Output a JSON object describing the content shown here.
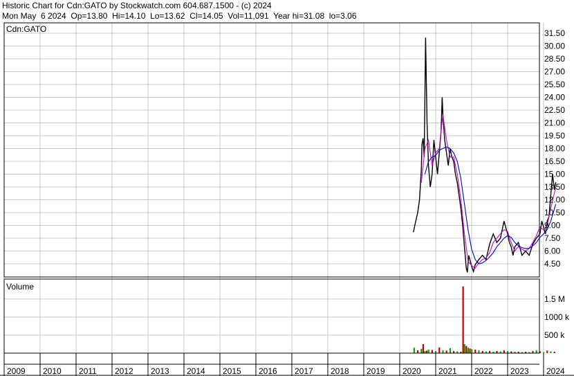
{
  "header": {
    "title": "Historic Chart for Cdn:GATO by Stockwatch.com 604.687.1500 - (c) 2024",
    "quote": "Mon May  6 2024  Op=13.80  Hi=14.10  Lo=13.62  Cl=14.05  Vol=11,091  Year hi=31.08  lo=3.06"
  },
  "chart_data": [
    {
      "type": "line",
      "panel_label": "Cdn:GATO",
      "ylim": [
        3.0,
        33.5
      ],
      "y_ticks": [
        "31.50",
        "30.00",
        "28.50",
        "27.00",
        "25.50",
        "24.00",
        "22.50",
        "21.00",
        "19.50",
        "18.00",
        "16.50",
        "15.00",
        "13.50",
        "12.00",
        "10.50",
        "9.00",
        "7.50",
        "6.00",
        "4.50"
      ],
      "x_ticks": [
        "2009",
        "2010",
        "2011",
        "2012",
        "2013",
        "2014",
        "2015",
        "2016",
        "2017",
        "2018",
        "2019",
        "2020",
        "2021",
        "2022",
        "2023",
        "2024"
      ],
      "grid": true,
      "series": [
        {
          "color": "#000000",
          "x": [
            2020.38,
            2020.42,
            2020.5,
            2020.55,
            2020.6,
            2020.62,
            2020.65,
            2020.68,
            2020.72,
            2020.76,
            2020.8,
            2020.85,
            2020.9,
            2020.95,
            2021.0,
            2021.05,
            2021.1,
            2021.15,
            2021.18,
            2021.2,
            2021.25,
            2021.3,
            2021.35,
            2021.4,
            2021.45,
            2021.5,
            2021.55,
            2021.6,
            2021.65,
            2021.7,
            2021.75,
            2021.8,
            2021.85,
            2021.88,
            2021.92,
            2021.95,
            2022.0,
            2022.05,
            2022.1,
            2022.2,
            2022.3,
            2022.4,
            2022.5,
            2022.6,
            2022.7,
            2022.8,
            2022.9,
            2023.0,
            2023.05,
            2023.1,
            2023.15,
            2023.2,
            2023.3,
            2023.4,
            2023.5,
            2023.6,
            2023.7,
            2023.8,
            2023.9,
            2023.95,
            2024.0,
            2024.05,
            2024.1,
            2024.15,
            2024.2,
            2024.25,
            2024.3,
            2024.34
          ],
          "values": [
            8.2,
            9.0,
            10.5,
            12.0,
            15.5,
            18.5,
            19.2,
            17.0,
            31.0,
            21.0,
            16.0,
            13.5,
            15.0,
            19.0,
            17.0,
            15.0,
            17.5,
            20.0,
            24.0,
            22.0,
            19.0,
            17.5,
            16.0,
            18.0,
            17.0,
            16.5,
            15.0,
            14.0,
            12.5,
            11.0,
            9.0,
            6.5,
            4.0,
            3.5,
            5.5,
            5.0,
            4.2,
            3.6,
            4.4,
            5.0,
            5.5,
            5.0,
            6.8,
            8.0,
            7.0,
            7.5,
            9.5,
            8.0,
            7.0,
            6.5,
            5.5,
            6.5,
            7.0,
            5.5,
            6.0,
            5.5,
            6.8,
            7.5,
            8.0,
            9.5,
            8.8,
            8.0,
            9.5,
            10.0,
            12.5,
            15.0,
            13.2,
            14.05
          ]
        },
        {
          "color": "#cc00cc",
          "x": [
            2020.6,
            2020.7,
            2020.8,
            2020.9,
            2021.0,
            2021.1,
            2021.2,
            2021.3,
            2021.4,
            2021.5,
            2021.6,
            2021.7,
            2021.8,
            2021.9,
            2022.0,
            2022.1,
            2022.2,
            2022.3,
            2022.4,
            2022.5,
            2022.6,
            2022.7,
            2022.8,
            2022.9,
            2023.0,
            2023.1,
            2023.2,
            2023.3,
            2023.4,
            2023.5,
            2023.6,
            2023.7,
            2023.8,
            2023.9,
            2024.0,
            2024.1,
            2024.2,
            2024.34
          ],
          "values": [
            14.0,
            18.0,
            19.0,
            16.0,
            17.5,
            18.0,
            22.0,
            19.0,
            17.0,
            17.0,
            15.0,
            12.0,
            8.0,
            4.8,
            4.3,
            4.0,
            4.6,
            5.0,
            5.2,
            5.8,
            7.0,
            7.5,
            8.0,
            8.5,
            8.3,
            7.0,
            6.0,
            6.5,
            6.2,
            6.0,
            6.3,
            7.0,
            7.8,
            8.8,
            8.5,
            9.0,
            11.0,
            13.5
          ]
        },
        {
          "color": "#0000cc",
          "x": [
            2020.7,
            2020.8,
            2020.9,
            2021.0,
            2021.1,
            2021.2,
            2021.3,
            2021.4,
            2021.5,
            2021.6,
            2021.7,
            2021.8,
            2021.9,
            2022.0,
            2022.1,
            2022.2,
            2022.3,
            2022.4,
            2022.5,
            2022.6,
            2022.7,
            2022.8,
            2022.9,
            2023.0,
            2023.1,
            2023.2,
            2023.3,
            2023.4,
            2023.5,
            2023.6,
            2023.7,
            2023.8,
            2023.9,
            2024.0,
            2024.1,
            2024.2,
            2024.34
          ],
          "values": [
            15.0,
            16.5,
            17.0,
            17.2,
            17.8,
            18.0,
            18.2,
            18.0,
            17.5,
            16.5,
            14.5,
            11.5,
            8.5,
            6.2,
            5.0,
            4.5,
            4.6,
            4.9,
            5.3,
            5.8,
            6.5,
            7.0,
            7.5,
            7.8,
            7.6,
            7.0,
            6.6,
            6.4,
            6.3,
            6.3,
            6.6,
            7.0,
            7.6,
            8.0,
            8.5,
            9.5,
            11.5
          ]
        }
      ]
    },
    {
      "type": "bar",
      "panel_label": "Volume",
      "y_ticks": [
        "1.5 M",
        "1000 k",
        "500 k"
      ],
      "ylim": [
        0,
        1900000
      ],
      "x": [
        2020.4,
        2020.5,
        2020.6,
        2020.65,
        2020.7,
        2020.75,
        2020.8,
        2020.9,
        2021.0,
        2021.1,
        2021.2,
        2021.3,
        2021.4,
        2021.5,
        2021.6,
        2021.7,
        2021.76,
        2021.8,
        2021.85,
        2021.9,
        2021.95,
        2022.0,
        2022.1,
        2022.2,
        2022.3,
        2022.4,
        2022.5,
        2022.6,
        2022.7,
        2022.8,
        2022.9,
        2023.0,
        2023.1,
        2023.2,
        2023.3,
        2023.4,
        2023.5,
        2023.6,
        2023.7,
        2023.8,
        2023.9,
        2024.0,
        2024.1,
        2024.2,
        2024.3
      ],
      "values": [
        150000,
        80000,
        120000,
        250000,
        60000,
        70000,
        100000,
        90000,
        60000,
        160000,
        80000,
        70000,
        140000,
        60000,
        50000,
        40000,
        1850000,
        250000,
        200000,
        150000,
        130000,
        110000,
        100000,
        80000,
        60000,
        50000,
        60000,
        40000,
        60000,
        50000,
        80000,
        60000,
        50000,
        40000,
        40000,
        30000,
        40000,
        30000,
        60000,
        80000,
        50000,
        30000,
        70000,
        50000,
        40000
      ],
      "colors": [
        "#00aa00",
        "#cc0000",
        "#00aa00",
        "#cc0000",
        "#00aa00",
        "#cc0000",
        "#00aa00",
        "#cc0000",
        "#00aa00",
        "#cc0000",
        "#00aa00",
        "#cc0000",
        "#00aa00",
        "#cc0000",
        "#00aa00",
        "#cc0000",
        "#cc0000",
        "#00aa00",
        "#cc0000",
        "#00aa00",
        "#cc0000",
        "#00aa00",
        "#cc0000",
        "#00aa00",
        "#cc0000",
        "#00aa00",
        "#cc0000",
        "#00aa00",
        "#cc0000",
        "#00aa00",
        "#cc0000",
        "#00aa00",
        "#cc0000",
        "#00aa00",
        "#cc0000",
        "#00aa00",
        "#cc0000",
        "#00aa00",
        "#cc0000",
        "#00aa00",
        "#cc0000",
        "#00aa00",
        "#cc0000",
        "#00aa00",
        "#cc0000"
      ]
    }
  ]
}
